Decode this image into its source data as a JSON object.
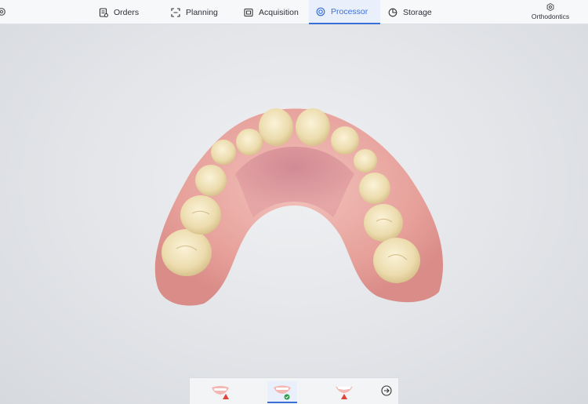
{
  "nav": {
    "settings_icon": "gear-icon",
    "tabs": [
      {
        "label": "Orders",
        "icon": "orders-icon"
      },
      {
        "label": "Planning",
        "icon": "planning-icon"
      },
      {
        "label": "Acquisition",
        "icon": "acquisition-icon"
      },
      {
        "label": "Processor",
        "icon": "processor-icon",
        "active": true
      },
      {
        "label": "Storage",
        "icon": "storage-icon"
      }
    ],
    "workflow": {
      "label": "Orthodontics",
      "icon": "gear-icon"
    }
  },
  "viewport": {
    "content": "upper-jaw-scan-model"
  },
  "jaw_selector": {
    "items": [
      {
        "icon": "upper-jaw-icon",
        "status": "warning"
      },
      {
        "icon": "both-jaws-icon",
        "status": "complete",
        "selected": true
      },
      {
        "icon": "lower-jaw-icon",
        "status": "warning"
      }
    ],
    "next_icon": "arrow-right-circle-icon"
  },
  "colors": {
    "accent": "#3b6fd6",
    "warning": "#e0433a",
    "success": "#2e9c4a",
    "gum": "#e9a3a0",
    "tooth": "#efe0b4"
  }
}
